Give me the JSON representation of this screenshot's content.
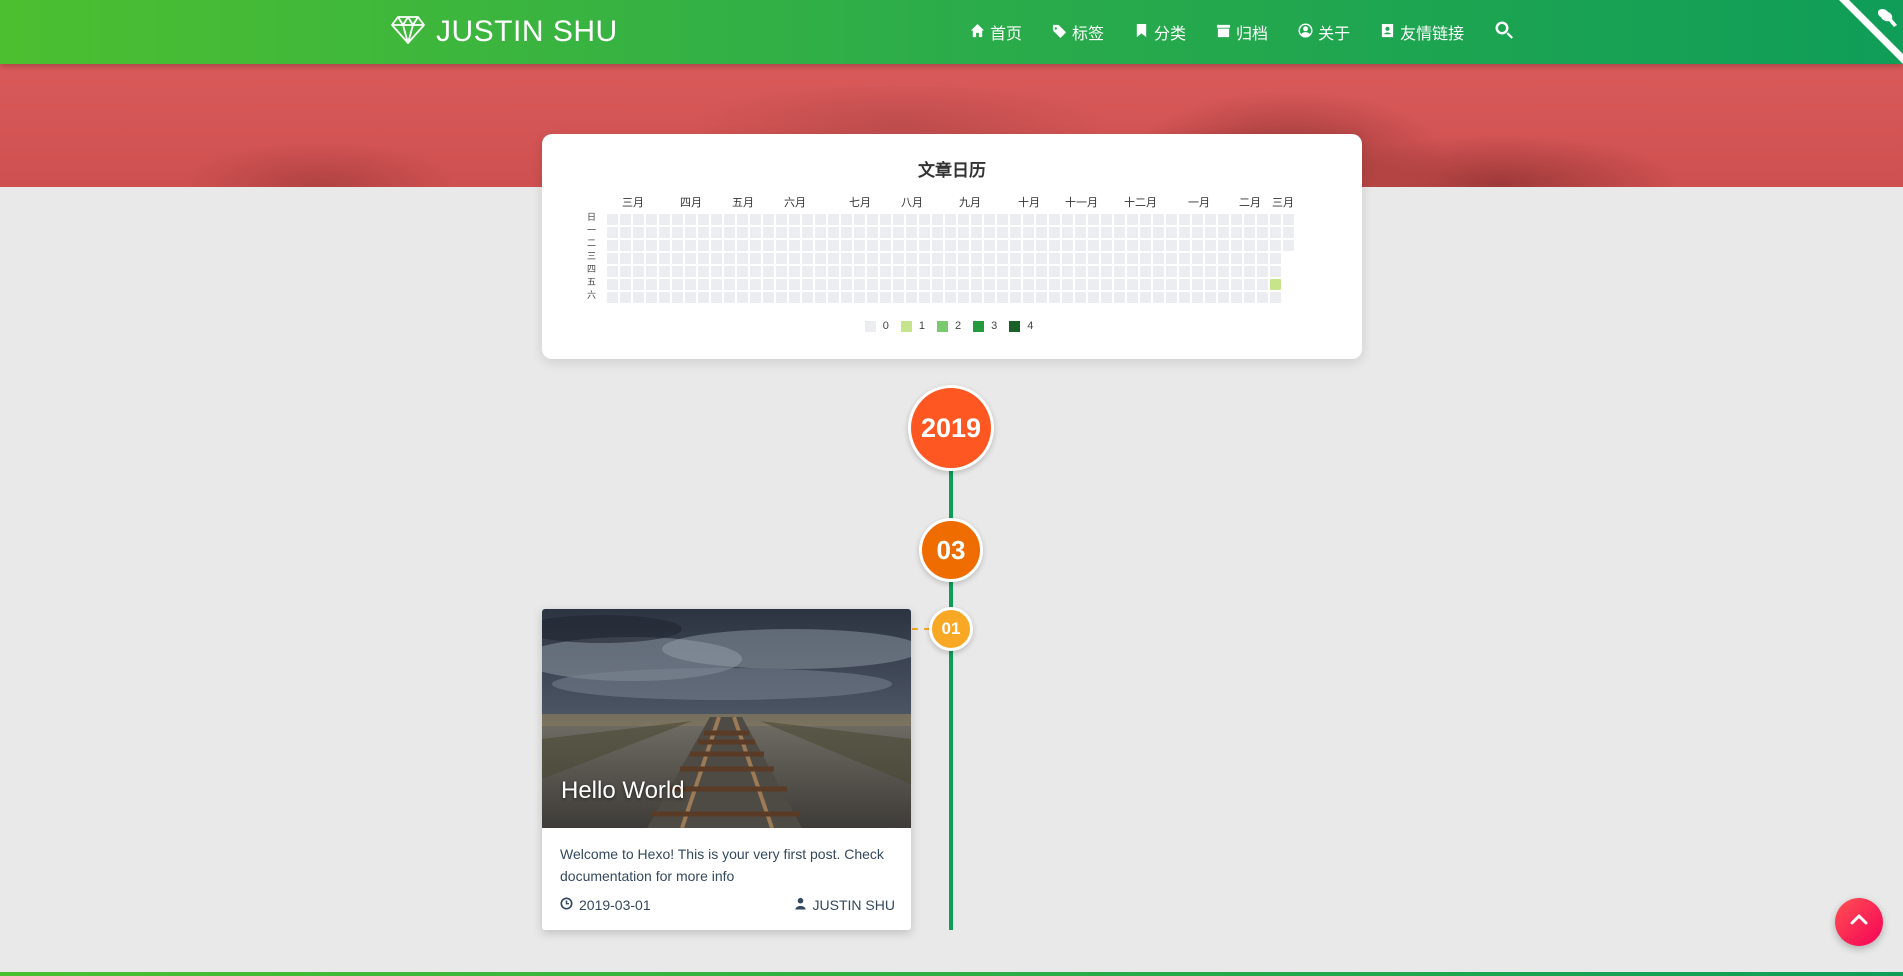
{
  "brand": {
    "title": "JUSTIN SHU",
    "icon": "diamond-icon"
  },
  "nav": {
    "items": [
      {
        "label": "首页",
        "icon": "home-icon"
      },
      {
        "label": "标签",
        "icon": "tags-icon"
      },
      {
        "label": "分类",
        "icon": "bookmark-icon"
      },
      {
        "label": "归档",
        "icon": "archive-icon"
      },
      {
        "label": "关于",
        "icon": "user-circle-icon"
      },
      {
        "label": "友情链接",
        "icon": "address-book-icon"
      }
    ],
    "search_icon": "search-icon"
  },
  "calendar": {
    "title": "文章日历",
    "months": [
      "三月",
      "四月",
      "五月",
      "六月",
      "七月",
      "八月",
      "九月",
      "十月",
      "十一月",
      "十二月",
      "一月",
      "二月",
      "三月"
    ],
    "weekdays": [
      "日",
      "一",
      "二",
      "三",
      "四",
      "五",
      "六"
    ],
    "legend": [
      {
        "label": "0",
        "color": "#ebedf0"
      },
      {
        "label": "1",
        "color": "#c6e48b"
      },
      {
        "label": "2",
        "color": "#7bc96f"
      },
      {
        "label": "3",
        "color": "#239a3b"
      },
      {
        "label": "4",
        "color": "#196127"
      }
    ],
    "activity": [
      {
        "date": "2019-03-01",
        "count": 1
      }
    ]
  },
  "timeline": {
    "year": "2019",
    "month": "03",
    "day": "01",
    "colors": {
      "line": "#0f9d58",
      "year": "#ff5722",
      "month": "#ef6c00",
      "day": "#f9a825"
    }
  },
  "post": {
    "title": "Hello World",
    "excerpt": "Welcome to Hexo! This is your very first post. Check documentation for more info",
    "date": "2019-03-01",
    "author": "JUSTIN SHU"
  },
  "back_to_top_icon": "chevron-up-icon",
  "colors": {
    "accent": "#0f9d58",
    "hero": "#d95a5a",
    "back_to_top": "#ff4069"
  }
}
